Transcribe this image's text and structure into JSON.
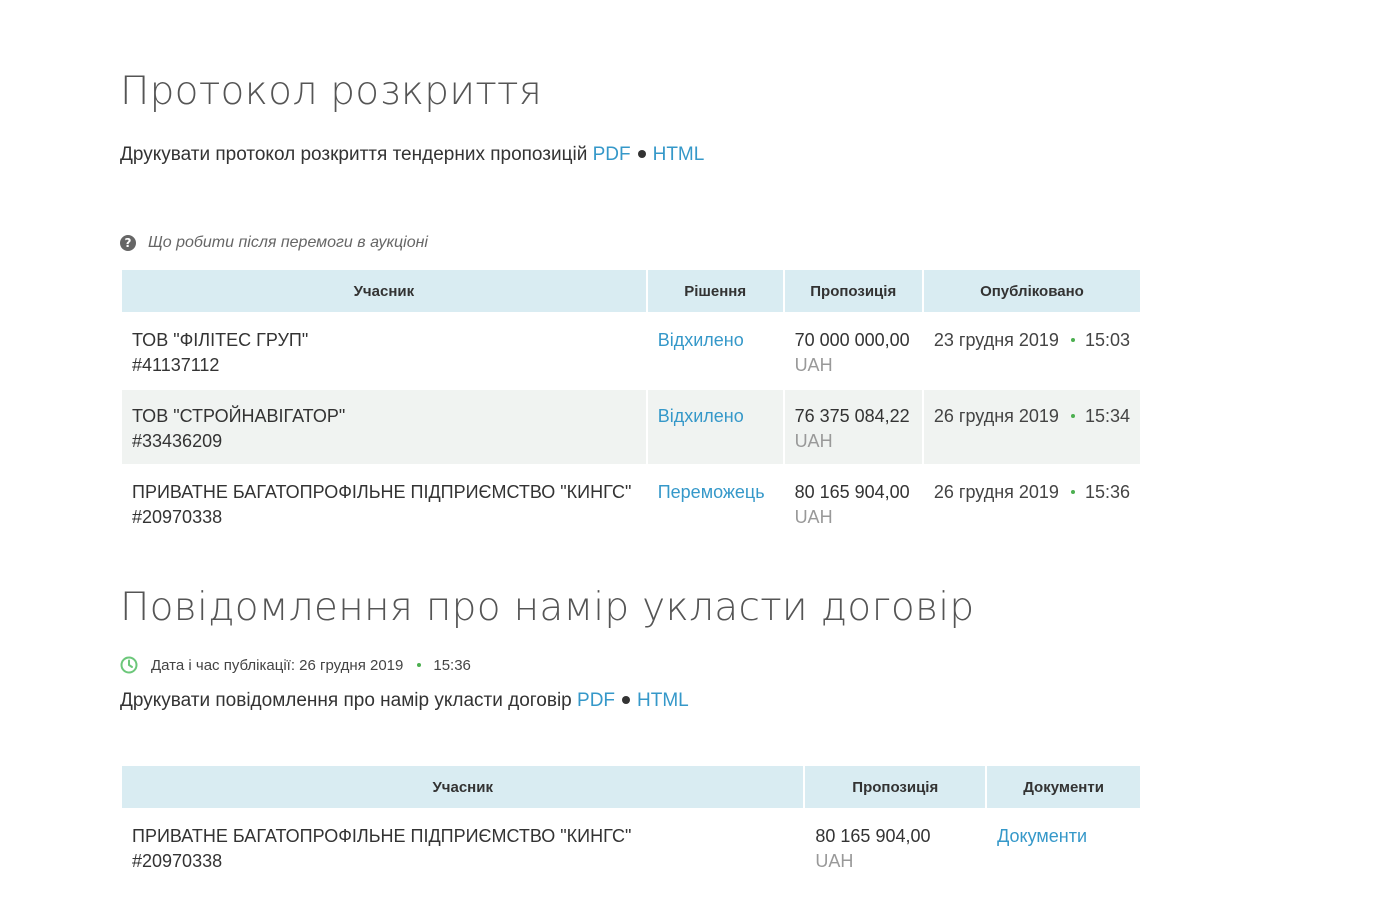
{
  "protocol": {
    "title": "Протокол розкриття",
    "print_text": "Друкувати протокол розкриття тендерних пропозицій",
    "pdf_label": "PDF",
    "html_label": "HTML",
    "help_text": "Що робити після перемоги в аукціоні",
    "columns": [
      "Учасник",
      "Рішення",
      "Пропозиція",
      "Опубліковано"
    ],
    "rows": [
      {
        "name": "ТОВ \"ФІЛІТЕС ГРУП\"",
        "code": "#41137112",
        "decision": "Відхилено",
        "amount": "70 000 000,00",
        "currency": "UAH",
        "date": "23 грудня 2019",
        "time": "15:03"
      },
      {
        "name": "ТОВ \"СТРОЙНАВІГАТОР\"",
        "code": "#33436209",
        "decision": "Відхилено",
        "amount": "76 375 084,22",
        "currency": "UAH",
        "date": "26 грудня 2019",
        "time": "15:34"
      },
      {
        "name": "ПРИВАТНЕ БАГАТОПРОФІЛЬНЕ ПІДПРИЄМСТВО \"КИНГС\"",
        "code": "#20970338",
        "decision": "Переможець",
        "amount": "80 165 904,00",
        "currency": "UAH",
        "date": "26 грудня 2019",
        "time": "15:36"
      }
    ]
  },
  "notice": {
    "title": "Повідомлення про намір укласти договір",
    "pub_label": "Дата і час публікації: 26 грудня 2019",
    "pub_time": "15:36",
    "print_text": "Друкувати повідомлення про намір укласти договір",
    "pdf_label": "PDF",
    "html_label": "HTML",
    "columns": [
      "Учасник",
      "Пропозиція",
      "Документи"
    ],
    "rows": [
      {
        "name": "ПРИВАТНЕ БАГАТОПРОФІЛЬНЕ ПІДПРИЄМСТВО \"КИНГС\"",
        "code": "#20970338",
        "amount": "80 165 904,00",
        "currency": "UAH",
        "docs_label": "Документи"
      }
    ]
  },
  "colors": {
    "link": "#3598c9",
    "header_bg": "#d9ecf2",
    "alt_row_bg": "#f0f3f1",
    "accent_dot": "#4caf50"
  },
  "icons": {
    "help": "question-circle-icon",
    "clock": "clock-icon"
  }
}
